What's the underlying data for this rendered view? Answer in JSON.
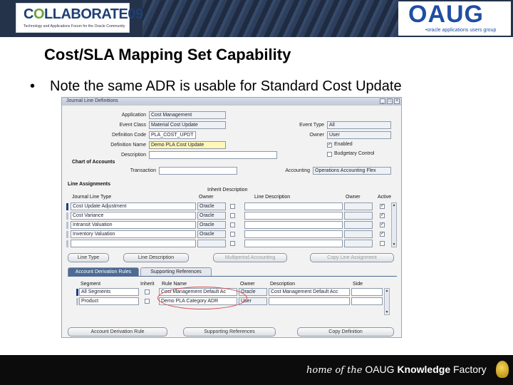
{
  "header": {
    "collab_word_a": "C",
    "collab_word_o": "O",
    "collab_word_b": "LLABORATE",
    "collab_year": "09",
    "collab_tagline": "Technology and Applications Forum for the Oracle Community",
    "oaug_word": "OAUG",
    "oaug_sub": "•oracle applications users group"
  },
  "slide": {
    "title": "Cost/SLA Mapping Set Capability",
    "bullet_mark": "•",
    "bullet": "Note the same ADR is usable for Standard Cost Update"
  },
  "form": {
    "title": "Journal Line Definitions",
    "win_buttons": [
      "_",
      "□",
      "×"
    ],
    "fields_left": [
      {
        "label": "Application",
        "value": "Cost Management"
      },
      {
        "label": "Event Class",
        "value": "Material Cost Update"
      },
      {
        "label": "Definition Code",
        "value": "PLA_COST_UPDT"
      },
      {
        "label": "Definition Name",
        "value": "Demo PLA Cost Update"
      },
      {
        "label": "Description",
        "value": ""
      }
    ],
    "fields_right": [
      {
        "label": "Event Type",
        "value": "All"
      },
      {
        "label": "Owner",
        "value": "User"
      }
    ],
    "enabled_label": "Enabled",
    "budgetary_label": "Budgetary Control",
    "chart_of_accounts": {
      "section": "Chart of Accounts",
      "transaction_label": "Transaction",
      "transaction_value": "",
      "accounting_label": "Accounting",
      "accounting_value": "Operations Accounting Flex"
    },
    "line_assignments": {
      "section": "Line Assignments",
      "inherit_desc_label": "Inherit Description",
      "headers": {
        "line_type": "Journal Line Type",
        "owner": "Owner",
        "line_desc": "Line Description",
        "owner2": "Owner",
        "active": "Active"
      },
      "rows": [
        {
          "line_type": "Cost Update Adjustment",
          "owner": "Oracle",
          "active": "✓"
        },
        {
          "line_type": "Cost Variance",
          "owner": "Oracle",
          "active": "✓"
        },
        {
          "line_type": "Intransit Valuation",
          "owner": "Oracle",
          "active": "✓"
        },
        {
          "line_type": "Inventory Valuation",
          "owner": "Oracle",
          "active": "✓"
        },
        {
          "line_type": "",
          "owner": "",
          "active": ""
        }
      ],
      "buttons": [
        "Line Type",
        "Line Description",
        "Multiperiod Accounting",
        "Copy Line Assignment"
      ]
    },
    "tabs": [
      "Account Derivation Rules",
      "Supporting References"
    ],
    "adr": {
      "headers": {
        "segment": "Segment",
        "inherit": "Inherit",
        "rule_name": "Rule Name",
        "owner": "Owner",
        "description": "Description",
        "side": "Side"
      },
      "rows": [
        {
          "segment": "All Segments",
          "rule_name": "Cost Management Default Ac",
          "owner": "Oracle",
          "description": "Cost Management Default Acc"
        },
        {
          "segment": "Product",
          "rule_name": "Demo PLA Category ADR",
          "owner": "User",
          "description": ""
        }
      ]
    },
    "bottom_buttons": [
      "Account Derivation Rule",
      "Supporting References",
      "Copy Definition"
    ]
  },
  "footer": {
    "home_of_the": "home of the",
    "oaug": "OAUG",
    "knowledge": "Knowledge",
    "factory": "Factory"
  },
  "colors": {
    "banner": "#24324a",
    "accent_blue": "#1f4ea3",
    "highlight_oval": "#d64a4a",
    "active_tab": "#4d6b95"
  }
}
